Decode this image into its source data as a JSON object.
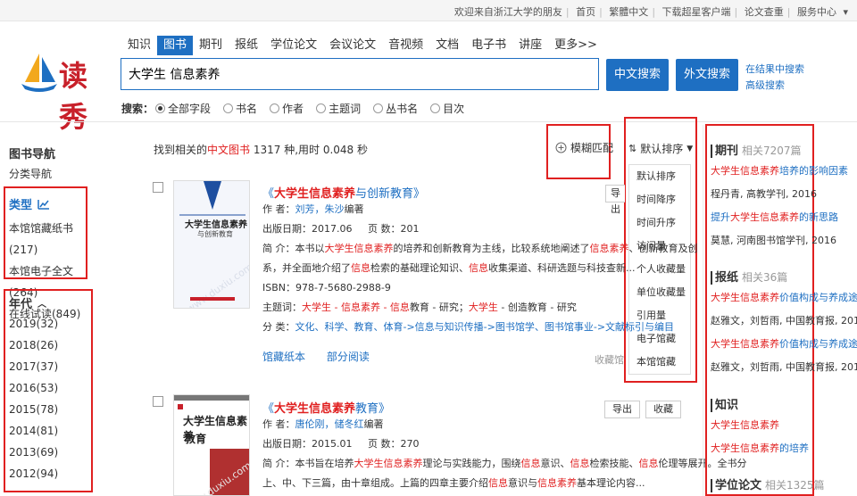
{
  "topbar": {
    "welcome": "欢迎来自浙江大学的朋友",
    "links": [
      "首页",
      "繁體中文",
      "下载超星客户端",
      "论文查重",
      "服务中心"
    ]
  },
  "logo": {
    "text": "读秀"
  },
  "nav": {
    "tabs": [
      "知识",
      "图书",
      "期刊",
      "报纸",
      "学位论文",
      "会议论文",
      "音视频",
      "文档",
      "电子书",
      "讲座",
      "更多>>"
    ],
    "active": "图书"
  },
  "search": {
    "value": "大学生 信息素养",
    "btn_cn": "中文搜索",
    "btn_foreign": "外文搜索",
    "in_results": "在结果中搜索",
    "advanced": "高级搜索"
  },
  "fields": {
    "label": "搜索：",
    "options": [
      "全部字段",
      "书名",
      "作者",
      "主题词",
      "丛书名",
      "目次"
    ]
  },
  "left": {
    "title": "图书导航",
    "subtitle": "分类导航",
    "type_head": "类型",
    "types": [
      "本馆馆藏纸书(217)",
      "本馆电子全文(264)",
      "在线试读(849)"
    ],
    "year_head": "年代",
    "years": [
      "2019(32)",
      "2018(26)",
      "2017(37)",
      "2016(53)",
      "2015(78)",
      "2014(81)",
      "2013(69)",
      "2012(94)"
    ]
  },
  "results": {
    "found_pre": "找到相关的",
    "found_red": "中文图书",
    "found_post": "1317 种,用时 0.048 秒",
    "fuzzy": "模糊匹配",
    "sort": "默认排序",
    "sort_options": [
      "默认排序",
      "时间降序",
      "时间升序",
      "访问量",
      "个人收藏量",
      "单位收藏量",
      "引用量",
      "电子馆藏",
      "本馆馆藏"
    ]
  },
  "book1": {
    "title_pre": "《",
    "title_red": "大学生信息素养",
    "title_post": "与创新教育》",
    "author_lbl": "作 者：",
    "author": "刘芳，朱沙",
    "author_suffix": "编著",
    "date": "出版日期：2017.06",
    "pages": "页 数：201",
    "intro_lbl": "简 介：本书以",
    "intro_red1": "大学生信息素养",
    "intro_mid1": "的培养和创新教育为主线，比较系统地阐述了",
    "intro_red2": "信息素养",
    "intro_mid2": "、创新教育及",
    "intro_mid2b": "创",
    "intro2_pre": "系，并全面地介绍了",
    "intro2_red1": "信息",
    "intro2_mid": "检索的基础理论知识、",
    "intro2_red2": "信息",
    "intro2_post": "收集渠道、科研选题与科技查新...",
    "isbn": "ISBN：978-7-5680-2988-9",
    "subject_lbl": "主题词：",
    "subject_red1": "大学生 - 信息素养 - 信息",
    "subject_mid": "教育 - 研究；",
    "subject_red2": "大学生",
    "subject_post": " - 创造教育 - 研究",
    "class_lbl": "分 类：",
    "class_val": "文化、科学、教育、体育->信息与知识传播->图书馆学、图书馆事业->文献标引与编目",
    "link1": "馆藏纸本",
    "link2": "部分阅读",
    "collect": "收藏馆:2",
    "export": "导出",
    "cover_title": "大学生信息素养",
    "cover_sub": "与创新教育"
  },
  "book2": {
    "title_pre": "《",
    "title_red": "大学生信息素养",
    "title_post": "教育》",
    "author_lbl": "作 者：",
    "author": "唐伦刚，储冬红",
    "author_suffix": "编著",
    "date": "出版日期：2015.01",
    "pages": "页 数：270",
    "intro_lbl": "简 介：本书旨在培养",
    "intro_red1": "大学生信息素养",
    "intro_mid1": "理论与实践能力，围绕",
    "intro_red2": "信息",
    "intro_mid2": "意识、",
    "intro_red3": "信息",
    "intro_mid3": "检索技能、",
    "intro_red4": "信息",
    "intro_post": "伦理等展开。全书分",
    "intro2_pre": "上、中、下三篇，由十章组成。上篇的四章主要介绍",
    "intro2_red1": "信息",
    "intro2_mid": "意识与",
    "intro2_red2": "信息素养",
    "intro2_post": "基本理论内容...",
    "export": "导出",
    "collect_btn": "收藏",
    "cover_title": "大学生信息素养",
    "cover_sub": "教育"
  },
  "right": {
    "journal": {
      "head": "期刊",
      "count": "相关7207篇",
      "items": [
        {
          "red": "大学生信息素养",
          "post": "培养的影响因素",
          "meta": "程丹青, 高教学刊, 2016"
        },
        {
          "pre": "提升",
          "red": "大学生信息素养",
          "post": "的新思路",
          "meta": "莫慧, 河南图书馆学刊, 2016"
        }
      ]
    },
    "newspaper": {
      "head": "报纸",
      "count": "相关36篇",
      "items": [
        {
          "red": "大学生信息素养",
          "post": "价值构成与养成途径",
          "meta": "赵雅文，刘哲雨, 中国教育报, 2018"
        },
        {
          "red": "大学生信息素养",
          "post": "价值构成与养成途径",
          "meta": "赵雅文，刘哲雨, 中国教育报, 2018"
        }
      ]
    },
    "knowledge": {
      "head": "知识",
      "items": [
        {
          "red": "大学生信息素养",
          "post": ""
        },
        {
          "red": "大学生信息素养",
          "post": "的培养"
        }
      ]
    },
    "thesis": {
      "head": "学位论文",
      "count": "相关1325篇"
    }
  }
}
